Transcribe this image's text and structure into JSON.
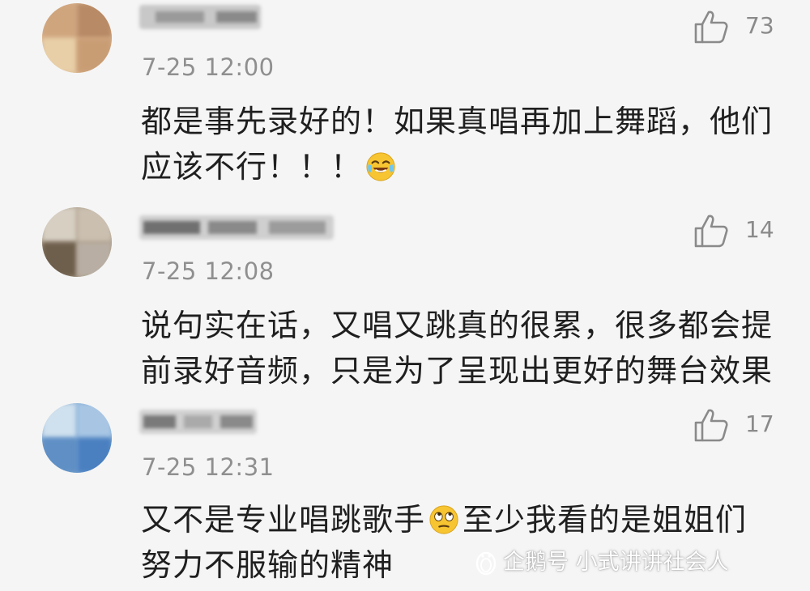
{
  "comments": [
    {
      "username": "",
      "timestamp": "7-25 12:00",
      "likes": "73",
      "text_line1": "都是事先录好的！如果真唱再加上舞蹈，他们",
      "text_line2": "应该不行！！！",
      "emoji": "laughing-crying-emoji-icon"
    },
    {
      "username": "",
      "timestamp": "7-25 12:08",
      "likes": "14",
      "text_line1": "说句实在话，又唱又跳真的很累，很多都会提",
      "text_line2": "前录好音频，只是为了呈现出更好的舞台效果"
    },
    {
      "username": "",
      "timestamp": "7-25 12:31",
      "likes": "17",
      "text_line1a": "又不是专业唱跳歌手",
      "text_line1b": "至少我看的是姐姐们",
      "text_line2": "努力不服输的精神",
      "emoji": "eye-roll-emoji-icon"
    }
  ],
  "watermark": {
    "text": "企鹅号 小式讲讲社会人",
    "icon": "penguin-logo-icon"
  },
  "colors": {
    "background": "#f5f5f5",
    "timestamp": "#8f8f8f",
    "like_icon": "#8a8a8a",
    "text": "#1f1f1f"
  }
}
